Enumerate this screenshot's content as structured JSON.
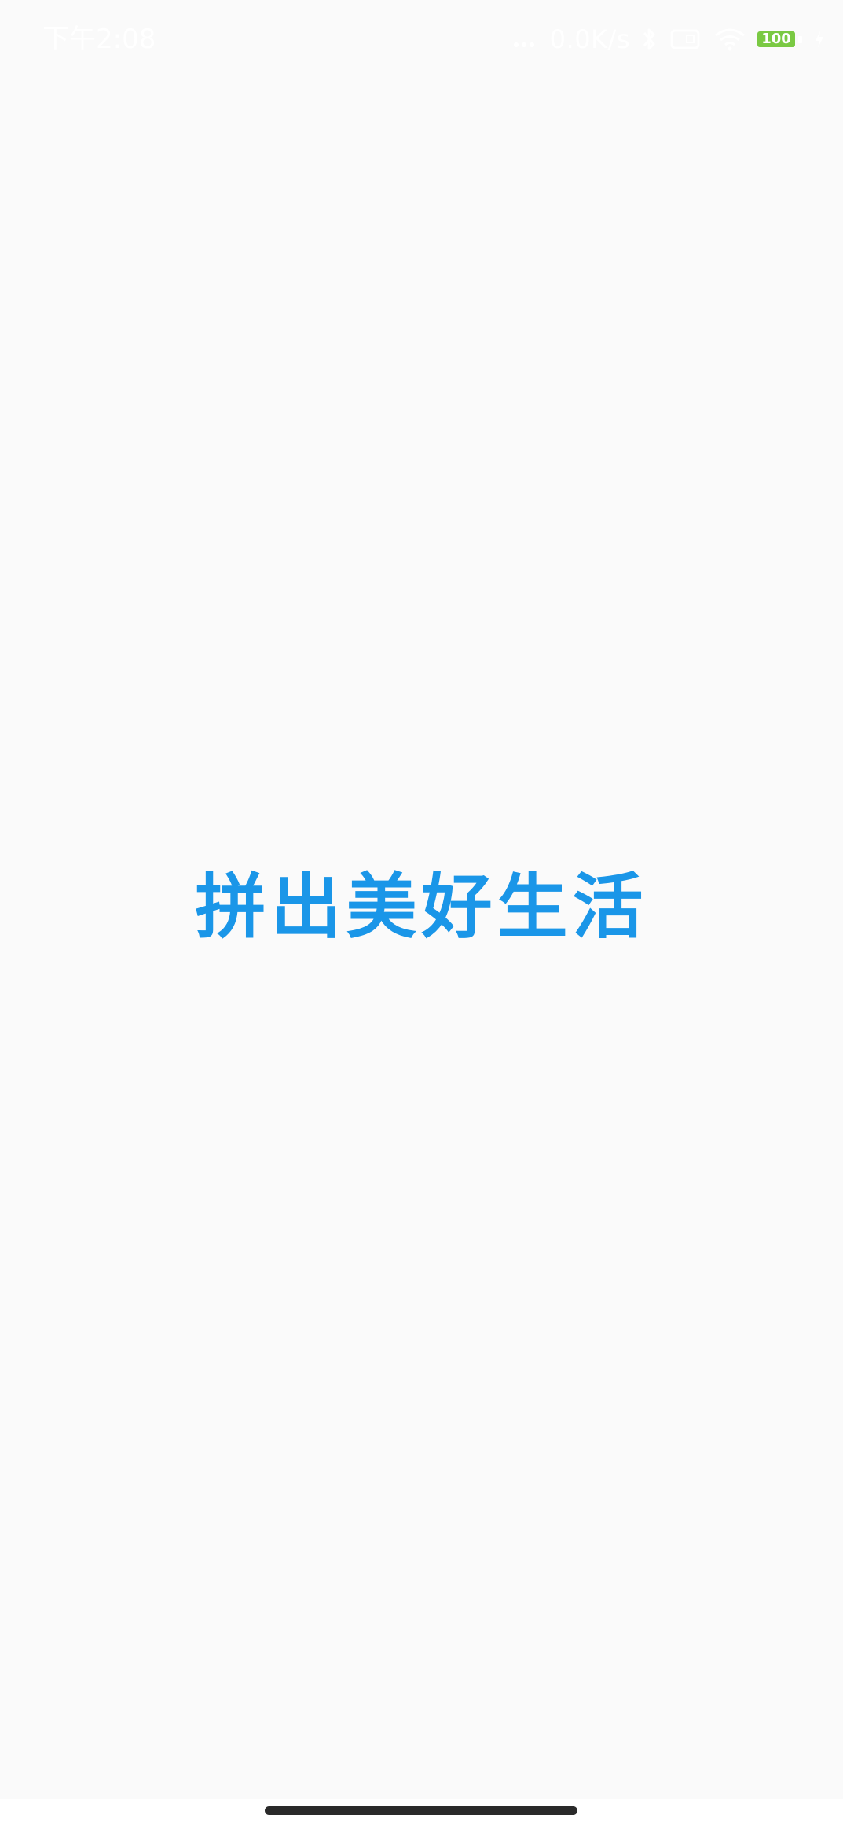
{
  "status_bar": {
    "time": "下午2:08",
    "net_speed": "0.0K/s",
    "battery_level": "100",
    "battery_fraction": 1.0,
    "battery_color": "#7ac943",
    "icons": [
      "signal-dots-icon",
      "bluetooth-icon",
      "sim-icon",
      "wifi-icon",
      "battery-icon",
      "charging-icon"
    ]
  },
  "splash": {
    "slogan": "拼出美好生活",
    "slogan_color": "#1a96e8"
  },
  "background_color": "#fafafa"
}
